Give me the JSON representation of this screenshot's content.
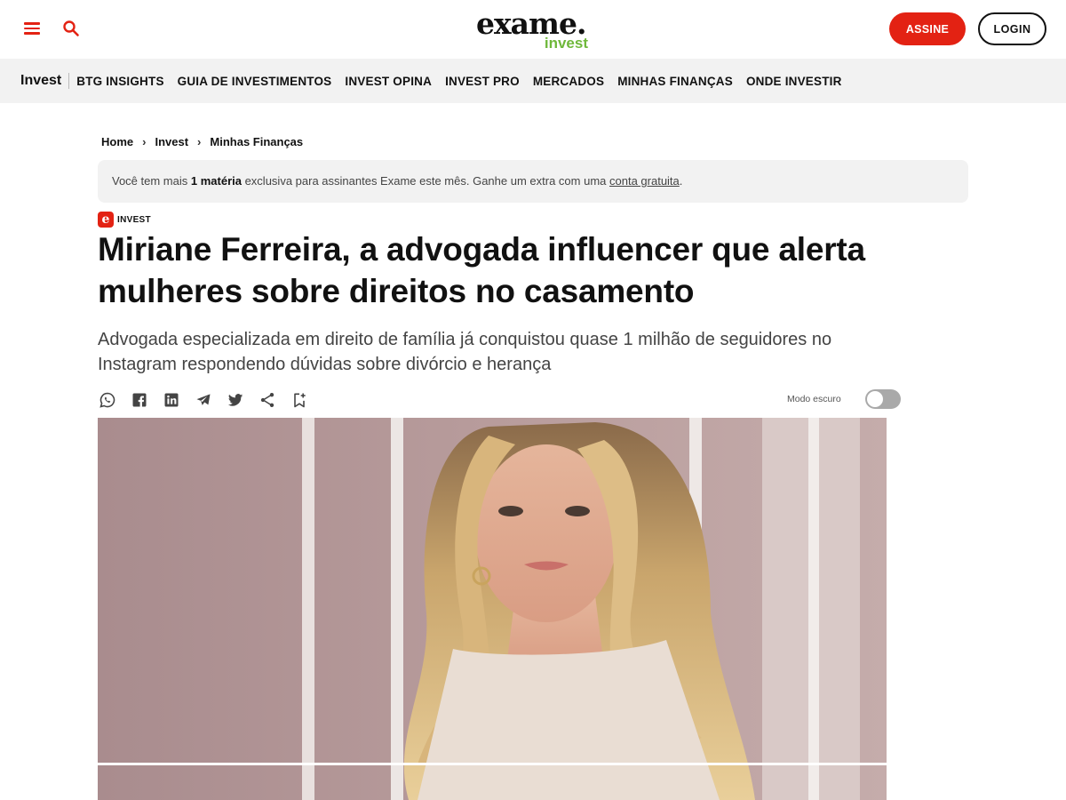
{
  "header": {
    "logo_main": "exame.",
    "logo_sub": "invest",
    "subscribe_label": "ASSINE",
    "login_label": "LOGIN"
  },
  "nav": {
    "home_label": "Invest",
    "items": [
      {
        "label": "BTG INSIGHTS"
      },
      {
        "label": "GUIA DE INVESTIMENTOS"
      },
      {
        "label": "INVEST OPINA"
      },
      {
        "label": "INVEST PRO"
      },
      {
        "label": "MERCADOS"
      },
      {
        "label": "MINHAS FINANÇAS"
      },
      {
        "label": "ONDE INVESTIR"
      }
    ]
  },
  "breadcrumb": {
    "items": [
      "Home",
      "Invest",
      "Minhas Finanças"
    ],
    "separator": "›"
  },
  "notice": {
    "prefix": "Você tem mais ",
    "bold": "1 matéria",
    "middle": " exclusiva para assinantes Exame este mês. Ganhe um extra com uma ",
    "link": "conta gratuita",
    "suffix": "."
  },
  "article": {
    "tag_logo": "e",
    "tag_label": "INVEST",
    "title": "Miriane Ferreira, a advogada influencer que alerta mulheres sobre direitos no casamento",
    "subtitle": "Advogada especializada em direito de família já conquistou quase 1 milhão de seguidores no Instagram respondendo dúvidas sobre divórcio e herança"
  },
  "share": {
    "icons": [
      "whatsapp-icon",
      "facebook-icon",
      "linkedin-icon",
      "telegram-icon",
      "twitter-icon",
      "share-icon",
      "bookmark-add-icon"
    ],
    "dark_mode_label": "Modo escuro",
    "dark_mode_on": false
  },
  "colors": {
    "brand_red": "#e32213",
    "brand_green": "#6fb83b",
    "nav_bg": "#f2f2f2"
  }
}
